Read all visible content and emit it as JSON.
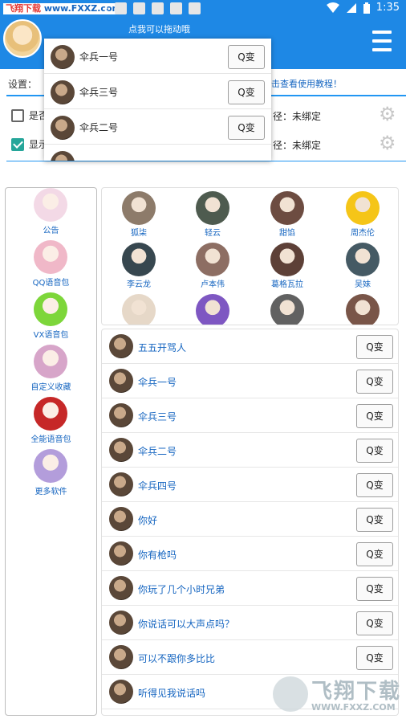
{
  "statusbar": {
    "watermark": "飞翔下载",
    "watermark_site": "www.FXXZ.com",
    "time": "1:35"
  },
  "topbar": {
    "drag_hint": "点我可以拖动哦"
  },
  "settings": {
    "label": "设置：",
    "tutorial": "击查看使用教程！",
    "rows": [
      {
        "label": "是否",
        "path": "径：未绑定",
        "checked": false
      },
      {
        "label": "显示",
        "path": "径：未绑定",
        "checked": true
      }
    ]
  },
  "popup": {
    "items": [
      {
        "label": "伞兵一号",
        "button": "Q变"
      },
      {
        "label": "伞兵三号",
        "button": "Q变"
      },
      {
        "label": "伞兵二号",
        "button": "Q变"
      }
    ]
  },
  "left_menu": [
    {
      "label": "公告",
      "color": "#f3d9e6"
    },
    {
      "label": "QQ语音包",
      "color": "#f0b8c8"
    },
    {
      "label": "VX语音包",
      "color": "#7dd63a"
    },
    {
      "label": "自定义收藏",
      "color": "#d7a5c9"
    },
    {
      "label": "全能语音包",
      "color": "#c62828"
    },
    {
      "label": "更多软件",
      "color": "#b39ddb"
    }
  ],
  "grid": [
    {
      "label": "狐柒",
      "color": "#8d7b6a"
    },
    {
      "label": "轻云",
      "color": "#4e5b4f"
    },
    {
      "label": "甜馅",
      "color": "#6d4c41"
    },
    {
      "label": "周杰伦",
      "color": "#f5c518"
    },
    {
      "label": "李云龙",
      "color": "#37474f"
    },
    {
      "label": "卢本伟",
      "color": "#8d6e63"
    },
    {
      "label": "葛格瓦拉",
      "color": "#5d4037"
    },
    {
      "label": "吴妹",
      "color": "#455a64"
    },
    {
      "label": "",
      "color": "#e6d8c8"
    },
    {
      "label": "",
      "color": "#7e57c2"
    },
    {
      "label": "",
      "color": "#616161"
    },
    {
      "label": "",
      "color": "#795548"
    }
  ],
  "list": [
    {
      "label": "五五开骂人",
      "button": "Q变"
    },
    {
      "label": "伞兵一号",
      "button": "Q变"
    },
    {
      "label": "伞兵三号",
      "button": "Q变"
    },
    {
      "label": "伞兵二号",
      "button": "Q变"
    },
    {
      "label": "伞兵四号",
      "button": "Q变"
    },
    {
      "label": "你好",
      "button": "Q变"
    },
    {
      "label": "你有枪吗",
      "button": "Q变"
    },
    {
      "label": "你玩了几个小时兄弟",
      "button": "Q变"
    },
    {
      "label": "你说话可以大声点吗？",
      "button": "Q变"
    },
    {
      "label": "可以不跟你多比比",
      "button": "Q变"
    },
    {
      "label": "听得见我说话吗",
      "button": ""
    }
  ],
  "watermark_br": {
    "name": "飞翔下载",
    "url": "WWW.FXXZ.COM"
  },
  "colors": {
    "primary": "#1e88e5",
    "link": "#1565c0",
    "accent": "#26a69a"
  }
}
